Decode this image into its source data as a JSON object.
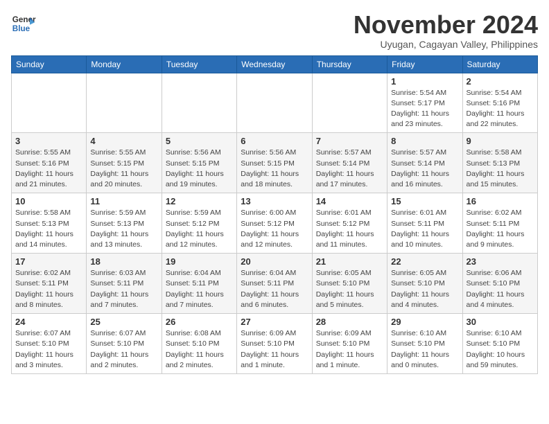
{
  "header": {
    "logo_line1": "General",
    "logo_line2": "Blue",
    "month": "November 2024",
    "location": "Uyugan, Cagayan Valley, Philippines"
  },
  "weekdays": [
    "Sunday",
    "Monday",
    "Tuesday",
    "Wednesday",
    "Thursday",
    "Friday",
    "Saturday"
  ],
  "weeks": [
    [
      {
        "day": "",
        "info": ""
      },
      {
        "day": "",
        "info": ""
      },
      {
        "day": "",
        "info": ""
      },
      {
        "day": "",
        "info": ""
      },
      {
        "day": "",
        "info": ""
      },
      {
        "day": "1",
        "info": "Sunrise: 5:54 AM\nSunset: 5:17 PM\nDaylight: 11 hours\nand 23 minutes."
      },
      {
        "day": "2",
        "info": "Sunrise: 5:54 AM\nSunset: 5:16 PM\nDaylight: 11 hours\nand 22 minutes."
      }
    ],
    [
      {
        "day": "3",
        "info": "Sunrise: 5:55 AM\nSunset: 5:16 PM\nDaylight: 11 hours\nand 21 minutes."
      },
      {
        "day": "4",
        "info": "Sunrise: 5:55 AM\nSunset: 5:15 PM\nDaylight: 11 hours\nand 20 minutes."
      },
      {
        "day": "5",
        "info": "Sunrise: 5:56 AM\nSunset: 5:15 PM\nDaylight: 11 hours\nand 19 minutes."
      },
      {
        "day": "6",
        "info": "Sunrise: 5:56 AM\nSunset: 5:15 PM\nDaylight: 11 hours\nand 18 minutes."
      },
      {
        "day": "7",
        "info": "Sunrise: 5:57 AM\nSunset: 5:14 PM\nDaylight: 11 hours\nand 17 minutes."
      },
      {
        "day": "8",
        "info": "Sunrise: 5:57 AM\nSunset: 5:14 PM\nDaylight: 11 hours\nand 16 minutes."
      },
      {
        "day": "9",
        "info": "Sunrise: 5:58 AM\nSunset: 5:13 PM\nDaylight: 11 hours\nand 15 minutes."
      }
    ],
    [
      {
        "day": "10",
        "info": "Sunrise: 5:58 AM\nSunset: 5:13 PM\nDaylight: 11 hours\nand 14 minutes."
      },
      {
        "day": "11",
        "info": "Sunrise: 5:59 AM\nSunset: 5:13 PM\nDaylight: 11 hours\nand 13 minutes."
      },
      {
        "day": "12",
        "info": "Sunrise: 5:59 AM\nSunset: 5:12 PM\nDaylight: 11 hours\nand 12 minutes."
      },
      {
        "day": "13",
        "info": "Sunrise: 6:00 AM\nSunset: 5:12 PM\nDaylight: 11 hours\nand 12 minutes."
      },
      {
        "day": "14",
        "info": "Sunrise: 6:01 AM\nSunset: 5:12 PM\nDaylight: 11 hours\nand 11 minutes."
      },
      {
        "day": "15",
        "info": "Sunrise: 6:01 AM\nSunset: 5:11 PM\nDaylight: 11 hours\nand 10 minutes."
      },
      {
        "day": "16",
        "info": "Sunrise: 6:02 AM\nSunset: 5:11 PM\nDaylight: 11 hours\nand 9 minutes."
      }
    ],
    [
      {
        "day": "17",
        "info": "Sunrise: 6:02 AM\nSunset: 5:11 PM\nDaylight: 11 hours\nand 8 minutes."
      },
      {
        "day": "18",
        "info": "Sunrise: 6:03 AM\nSunset: 5:11 PM\nDaylight: 11 hours\nand 7 minutes."
      },
      {
        "day": "19",
        "info": "Sunrise: 6:04 AM\nSunset: 5:11 PM\nDaylight: 11 hours\nand 7 minutes."
      },
      {
        "day": "20",
        "info": "Sunrise: 6:04 AM\nSunset: 5:11 PM\nDaylight: 11 hours\nand 6 minutes."
      },
      {
        "day": "21",
        "info": "Sunrise: 6:05 AM\nSunset: 5:10 PM\nDaylight: 11 hours\nand 5 minutes."
      },
      {
        "day": "22",
        "info": "Sunrise: 6:05 AM\nSunset: 5:10 PM\nDaylight: 11 hours\nand 4 minutes."
      },
      {
        "day": "23",
        "info": "Sunrise: 6:06 AM\nSunset: 5:10 PM\nDaylight: 11 hours\nand 4 minutes."
      }
    ],
    [
      {
        "day": "24",
        "info": "Sunrise: 6:07 AM\nSunset: 5:10 PM\nDaylight: 11 hours\nand 3 minutes."
      },
      {
        "day": "25",
        "info": "Sunrise: 6:07 AM\nSunset: 5:10 PM\nDaylight: 11 hours\nand 2 minutes."
      },
      {
        "day": "26",
        "info": "Sunrise: 6:08 AM\nSunset: 5:10 PM\nDaylight: 11 hours\nand 2 minutes."
      },
      {
        "day": "27",
        "info": "Sunrise: 6:09 AM\nSunset: 5:10 PM\nDaylight: 11 hours\nand 1 minute."
      },
      {
        "day": "28",
        "info": "Sunrise: 6:09 AM\nSunset: 5:10 PM\nDaylight: 11 hours\nand 1 minute."
      },
      {
        "day": "29",
        "info": "Sunrise: 6:10 AM\nSunset: 5:10 PM\nDaylight: 11 hours\nand 0 minutes."
      },
      {
        "day": "30",
        "info": "Sunrise: 6:10 AM\nSunset: 5:10 PM\nDaylight: 10 hours\nand 59 minutes."
      }
    ]
  ]
}
